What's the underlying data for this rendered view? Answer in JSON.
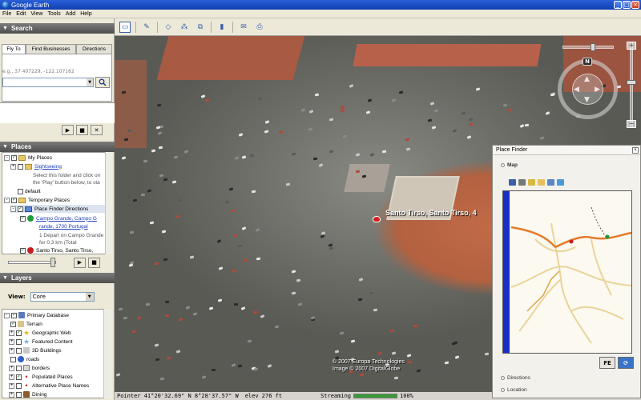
{
  "window": {
    "title": "Google Earth"
  },
  "menu": {
    "items": [
      "File",
      "Edit",
      "View",
      "Tools",
      "Add",
      "Help"
    ]
  },
  "search": {
    "header": "Search",
    "tabs": [
      "Fly To",
      "Find Businesses",
      "Directions"
    ],
    "hint": "e.g., 37 407229, -122.107162"
  },
  "places": {
    "header": "Places",
    "tree": [
      {
        "label": "My Places",
        "kind": "folder",
        "indent": 0
      },
      {
        "label": "Sightseeing",
        "kind": "link",
        "indent": 1
      },
      {
        "label": "Select this folder and click on",
        "kind": "desc",
        "indent": 2
      },
      {
        "label": "the 'Play' button below, to sta",
        "kind": "desc",
        "indent": 2
      },
      {
        "label": "default",
        "kind": "item",
        "indent": 1
      },
      {
        "label": "Temporary Places",
        "kind": "folder",
        "indent": 0
      },
      {
        "label": "Place Finder Directions",
        "kind": "selected",
        "indent": 1
      },
      {
        "label": "Campo Grande, Campo G",
        "kind": "link",
        "indent": 2
      },
      {
        "label": "rande, 1700 Portugal",
        "kind": "link",
        "indent": 2
      },
      {
        "label": "1 Depart on Campo Grande",
        "kind": "desc",
        "indent": 2
      },
      {
        "label": "for 0.3 km (Total",
        "kind": "desc",
        "indent": 2
      },
      {
        "label": "Santo Tirso, Santo Tirso,",
        "kind": "item",
        "indent": 2
      }
    ]
  },
  "layers": {
    "header": "Layers",
    "view_label": "View:",
    "view_value": "Core",
    "items": [
      {
        "label": "Primary Database",
        "icon": "database-icon",
        "color": "#5a7ab8"
      },
      {
        "label": "Terrain",
        "icon": "terrain-icon",
        "color": "#d8c48a"
      },
      {
        "label": "Geographic Web",
        "icon": "star-icon",
        "color": "#e8b820"
      },
      {
        "label": "Featured Content",
        "icon": "star-icon",
        "color": "#7ab0e8"
      },
      {
        "label": "3D Buildings",
        "icon": "building-icon",
        "color": "#c8c8c8"
      },
      {
        "label": "roads",
        "icon": "road-icon",
        "color": "#2f5ec8"
      },
      {
        "label": "borders",
        "icon": "flag-icon",
        "color": "#d8d8d8"
      },
      {
        "label": "Populated Places",
        "icon": "dot-icon",
        "color": "#c82020"
      },
      {
        "label": "Alternative Place Names",
        "icon": "dot-icon",
        "color": "#c82020"
      },
      {
        "label": "Dining",
        "icon": "dining-icon",
        "color": "#8a5a2a"
      }
    ]
  },
  "viewer": {
    "marker_label": "Santo Tirso, Santo Tirso, 4",
    "copyright_line1": "© 2007 Europa Technologies",
    "copyright_line2": "Image © 2007 DigitalGlobe",
    "nav_north": "N"
  },
  "place_finder": {
    "title": "Place Finder",
    "map_label": "Map",
    "directions_label": "Directions",
    "location_label": "Location",
    "btn_fe": "FE"
  },
  "status": {
    "pointer": "Pointer  41°20'32.69\" N   8°28'37.57\" W",
    "elev": "elev   276 ft",
    "streaming": "Streaming",
    "stream_percent": "100%",
    "stream_fraction": 1.0
  },
  "colors": {
    "title_bar": "#1e4fc4",
    "panel_bg": "#ece9d8",
    "section_header": "#606060",
    "link": "#2040c0",
    "route": "#e67a2a",
    "map_sidebar": "#1a2fc7"
  }
}
